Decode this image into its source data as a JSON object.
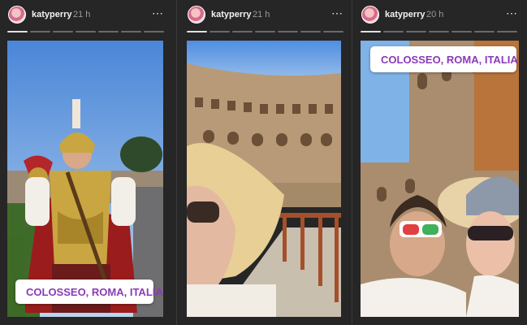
{
  "stories": [
    {
      "username": "katyperry",
      "time": "21 h",
      "more_icon": "⋯",
      "location": "COLOSSEO, ROMA, ITALIA",
      "progress_done": 1,
      "progress_total": 7
    },
    {
      "username": "katyperry",
      "time": "21 h",
      "more_icon": "⋯",
      "progress_done": 1,
      "progress_total": 7
    },
    {
      "username": "katyperry",
      "time": "20 h",
      "more_icon": "⋯",
      "location": "COLOSSEO, ROMA, ITALIA",
      "progress_done": 1,
      "progress_total": 7
    }
  ],
  "colors": {
    "background": "#262626",
    "location_text": "#8a3ab9"
  }
}
